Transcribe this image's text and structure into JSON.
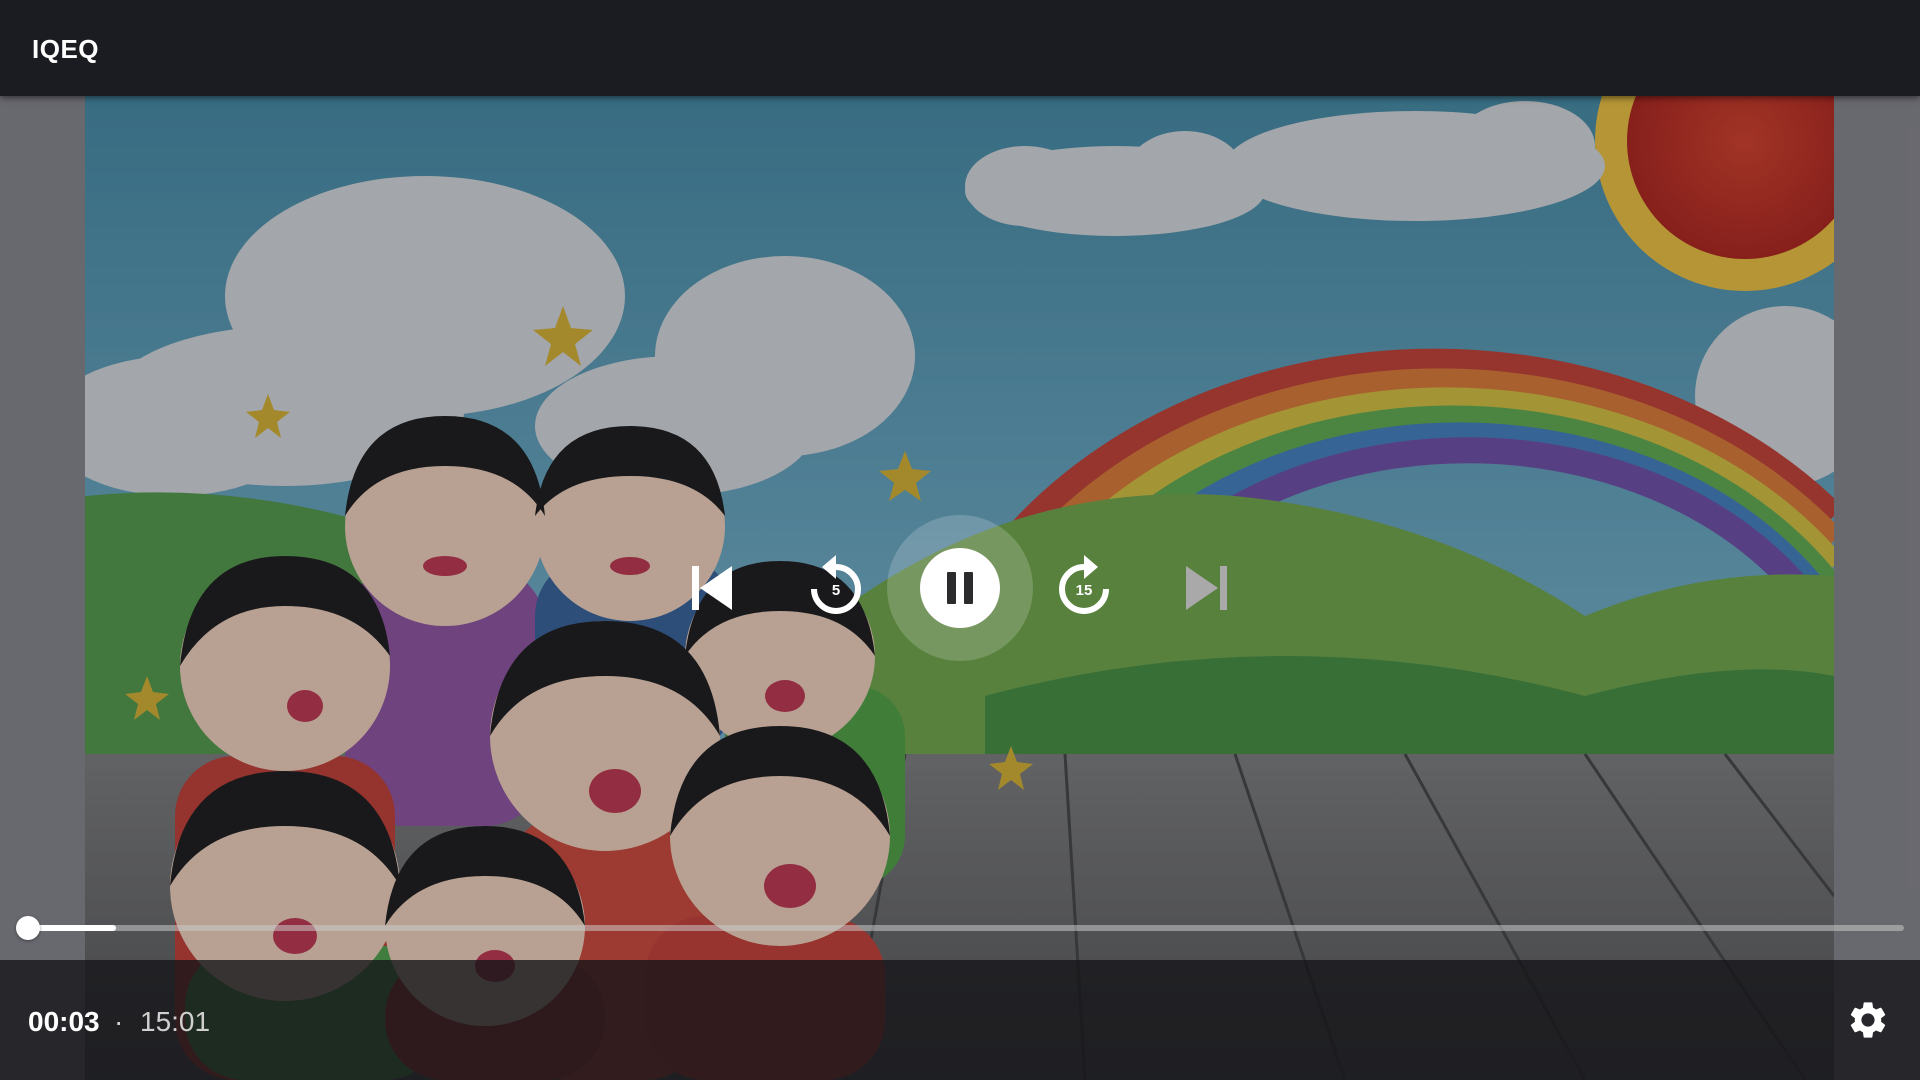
{
  "app": {
    "title": "IQEQ"
  },
  "player": {
    "current_time": "00:03",
    "separator": "·",
    "duration": "15:01",
    "progress_fraction": 0.0033,
    "buffered_fraction": 0.05,
    "state": "playing",
    "rewind_seconds": "5",
    "forward_seconds": "15"
  },
  "controls": {
    "previous_icon": "skip-previous-icon",
    "rewind_icon": "replay-5-icon",
    "pause_icon": "pause-icon",
    "forward_icon": "forward-15-icon",
    "next_icon": "skip-next-icon",
    "settings_icon": "gear-icon"
  },
  "colors": {
    "topbar": "#1b1c21",
    "accent": "#ffffff",
    "next_disabled": "#a9a9a9"
  }
}
